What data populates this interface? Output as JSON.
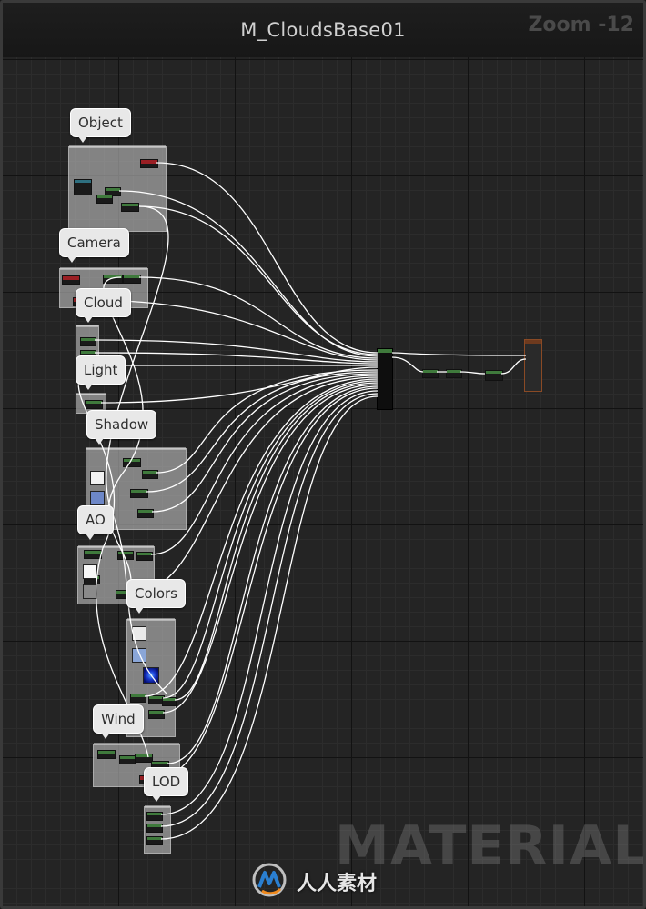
{
  "window": {
    "title": "M_CloudsBase01",
    "zoom_label": "Zoom -12"
  },
  "comments": {
    "object": "Object",
    "camera": "Camera",
    "cloud": "Cloud",
    "light": "Light",
    "shadow": "Shadow",
    "ao": "AO",
    "colors": "Colors",
    "wind": "Wind",
    "lod": "LOD"
  },
  "branding": {
    "watermark": "MATERIAL",
    "logo_text": "人人素材",
    "logo_icon": "cgmodel-logo-icon"
  },
  "colors": {
    "graph_background": "#242424",
    "node_header_green": "#3f7a3c",
    "node_header_red": "#9a1f24",
    "result_node_border": "#8a4a25",
    "wire": "#ffffff"
  }
}
